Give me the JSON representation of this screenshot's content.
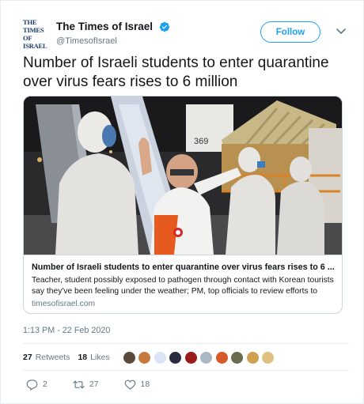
{
  "account": {
    "logo_line1": "THE TIMES",
    "logo_line2": "OF ISRAEL",
    "display_name": "The Times of Israel",
    "handle": "@TimesofIsrael",
    "verified": true
  },
  "follow_label": "Follow",
  "tweet_text": "Number of Israeli students to enter quarantine over virus fears rises to 6 million",
  "card": {
    "title": "Number of Israeli students to enter quarantine over virus fears rises to 6 ...",
    "description": "Teacher, student possibly exposed to pathogen through contact with Korean tourists say they've been feeling under the weather; PM, top officials to review efforts to",
    "domain": "timesofisrael.com",
    "image": "photo-people-in-protective-suits-at-airplane-stairs"
  },
  "timestamp": "1:13 PM - 22 Feb 2020",
  "stats": {
    "retweets_count": "27",
    "retweets_label": "Retweets",
    "likes_count": "18",
    "likes_label": "Likes"
  },
  "liker_avatars": [
    "#5a4a3a",
    "#c77a3d",
    "#dbe3f7",
    "#2b2b40",
    "#9b1b1b",
    "#aab7c4",
    "#d85a2a",
    "#6b6b50",
    "#d0a050",
    "#e0c080"
  ],
  "actions": {
    "reply_count": "2",
    "retweet_count": "27",
    "like_count": "18"
  },
  "colors": {
    "accent": "#1da1f2",
    "secondary_text": "#657786",
    "logo_blue": "#1b3a6b"
  }
}
